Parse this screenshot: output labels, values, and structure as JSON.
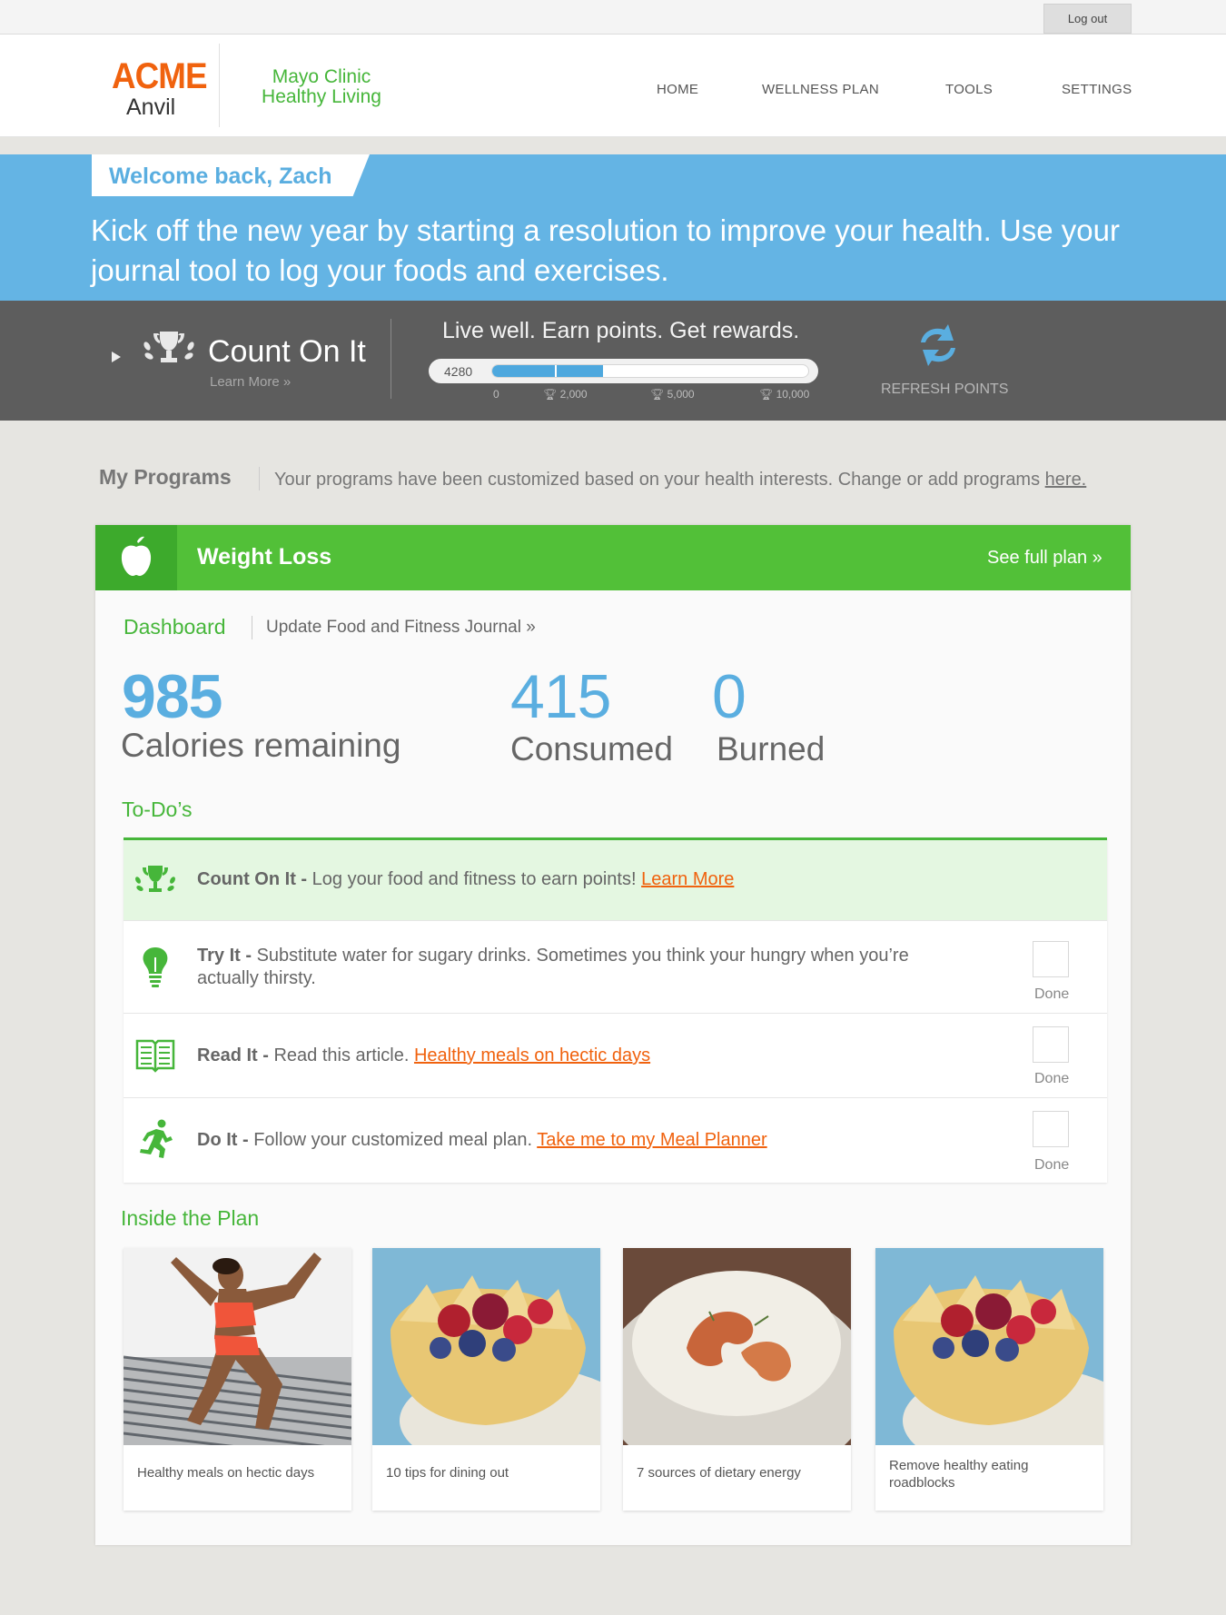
{
  "topbar": {
    "logout_label": "Log out"
  },
  "header": {
    "logo_main": "ACME",
    "logo_sub": "Anvil",
    "brand_line1": "Mayo Clinic",
    "brand_line2": "Healthy Living",
    "nav": [
      {
        "label": "HOME"
      },
      {
        "label": "WELLNESS PLAN"
      },
      {
        "label": "TOOLS"
      },
      {
        "label": "SETTINGS"
      }
    ]
  },
  "hero": {
    "welcome": "Welcome back, Zach",
    "message": "Kick off the new year by starting a resolution to improve your health. Use your journal tool to log your foods and exercises."
  },
  "count_on_it": {
    "title": "Count On It",
    "learn_more": "Learn More »",
    "tagline": "Live well. Earn points. Get rewards.",
    "points": "4280",
    "progress_fraction": 0.35,
    "milestones": [
      "0",
      "2,000",
      "5,000",
      "10,000"
    ],
    "refresh_label": "REFRESH POINTS",
    "icons": {
      "trophy": "trophy-icon",
      "refresh": "refresh-icon",
      "expand": "play-icon"
    }
  },
  "my_programs": {
    "title": "My Programs",
    "description": "Your programs have been customized based on your health interests. Change or add programs ",
    "link": "here."
  },
  "plan": {
    "title": "Weight Loss",
    "see_full": "See full plan »",
    "tabs": {
      "dashboard": "Dashboard",
      "journal": "Update Food and Fitness Journal »"
    },
    "stats": {
      "remaining_value": "985",
      "remaining_label": "Calories remaining",
      "consumed_value": "415",
      "consumed_label": "Consumed",
      "burned_value": "0",
      "burned_label": "Burned"
    },
    "todos_title": "To-Do’s",
    "todos": [
      {
        "bold": "Count On It - ",
        "text": "Log your food and fitness to earn points! ",
        "link": "Learn More",
        "icon": "trophy-icon"
      },
      {
        "bold": "Try It - ",
        "text": "Substitute water for sugary drinks. Sometimes you think your hungry when you’re actually thirsty.",
        "link": "",
        "icon": "lightbulb-icon",
        "done": "Done"
      },
      {
        "bold": "Read It - ",
        "text": "Read this article. ",
        "link": "Healthy meals on hectic days",
        "icon": "book-icon",
        "done": "Done"
      },
      {
        "bold": "Do It - ",
        "text": "Follow your customized meal plan. ",
        "link": "Take me to my Meal Planner",
        "icon": "running-person-icon",
        "done": "Done"
      }
    ],
    "inside_title": "Inside the Plan",
    "cards": [
      {
        "caption": "Healthy meals on hectic days"
      },
      {
        "caption": "10 tips for dining out"
      },
      {
        "caption": "7 sources of dietary energy"
      },
      {
        "caption": "Remove healthy eating roadblocks"
      }
    ]
  },
  "colors": {
    "accent_blue": "#64b4e4",
    "accent_green": "#52c038",
    "link_orange": "#f0620e",
    "dark_bar": "#5d5d5d"
  }
}
